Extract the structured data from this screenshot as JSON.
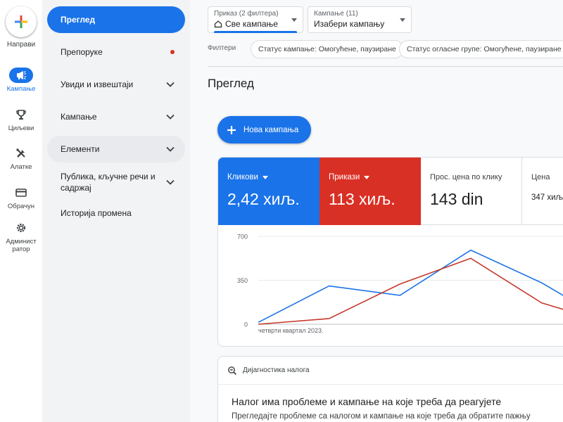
{
  "rail": {
    "create_label": "Направи",
    "items": [
      {
        "label": "Кампање",
        "icon": "megaphone-icon",
        "active": true
      },
      {
        "label": "Циљеви",
        "icon": "trophy-icon"
      },
      {
        "label": "Алатке",
        "icon": "tools-icon"
      },
      {
        "label": "Обрачун",
        "icon": "credit-card-icon"
      },
      {
        "label": "Админист ратор",
        "icon": "gear-icon"
      }
    ]
  },
  "sidenav": {
    "items": [
      {
        "label": "Преглед",
        "active": true
      },
      {
        "label": "Препоруке",
        "badge": "red-dot"
      },
      {
        "label": "Увиди и извештаји",
        "expandable": true
      },
      {
        "label": "Кампање",
        "expandable": true
      },
      {
        "label": "Елементи",
        "expandable": true,
        "hover": true
      },
      {
        "label": "Публика, кључне речи и садржај",
        "expandable": true
      },
      {
        "label": "Историја промена"
      }
    ]
  },
  "header": {
    "view_selector": {
      "label": "Приказ (2 филтера)",
      "value": "Све кампање"
    },
    "campaign_selector": {
      "label": "Кампање (11)",
      "value": "Изабери кампању"
    },
    "filters_label": "Филтери",
    "filter_chips": [
      "Статус кампање: Омогућене, паузиране",
      "Статус огласне групе: Омогућене, паузиране"
    ]
  },
  "page": {
    "title": "Преглед",
    "new_campaign_label": "Нова кампања"
  },
  "metrics": [
    {
      "label": "Кликови",
      "value": "2,42 хиљ.",
      "color": "#1a73e8"
    },
    {
      "label": "Прикази",
      "value": "113 хиљ.",
      "color": "#d93025"
    },
    {
      "label": "Прос. цена по клику",
      "value": "143 din"
    },
    {
      "label": "Цена",
      "value": "347 хиљ."
    }
  ],
  "chart_data": {
    "type": "line",
    "x": [
      0,
      1,
      2,
      3,
      4,
      5
    ],
    "x_tick_label": "четврти квартал 2023.",
    "y_ticks": [
      "700",
      "350",
      "0"
    ],
    "ylim": [
      0,
      700
    ],
    "series": [
      {
        "name": "Кликови",
        "color": "#1a73e8",
        "values": [
          15,
          305,
          230,
          590,
          330,
          0
        ]
      },
      {
        "name": "Прикази",
        "color": "#c5392b",
        "values": [
          0,
          45,
          320,
          525,
          170,
          0
        ]
      }
    ],
    "x_visible_max": 4.6,
    "grid": true
  },
  "diagnostics": {
    "header": "Дијагностика налога",
    "title": "Налог има проблеме и кампање на које треба да реагујете",
    "subtitle": "Прегледајте проблеме са налогом и кампање на које треба да обратите пажњу"
  }
}
